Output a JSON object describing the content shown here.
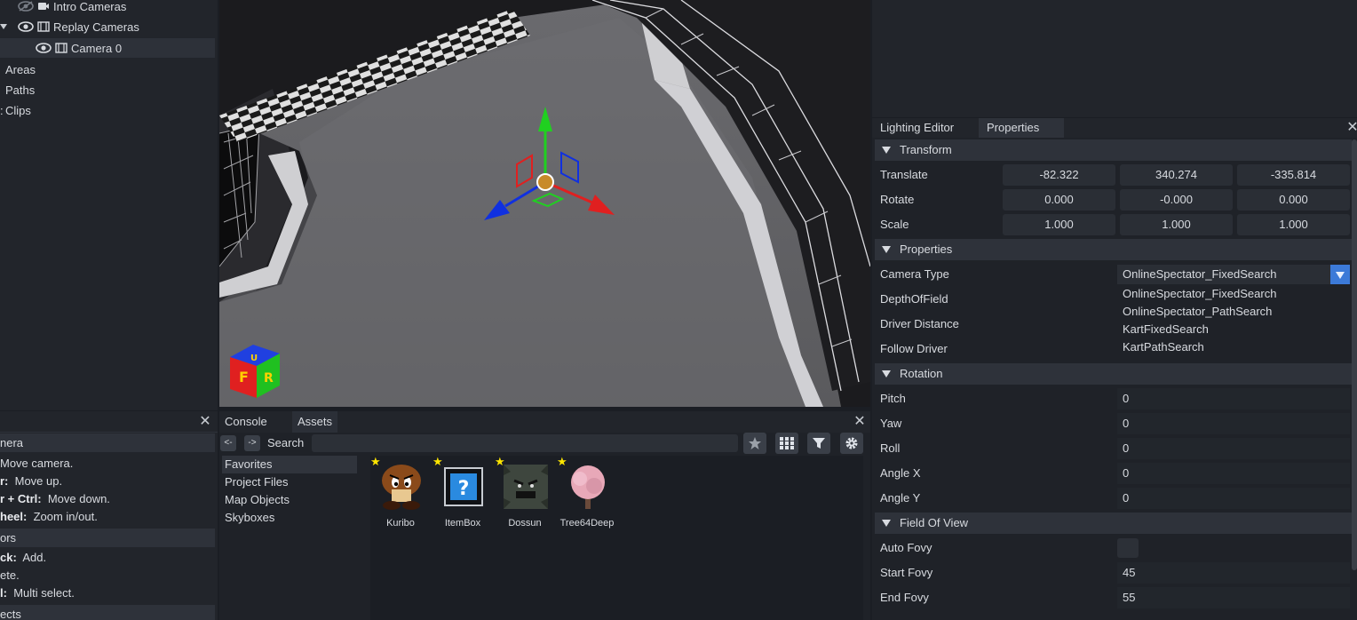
{
  "outliner": {
    "items": [
      {
        "label": "Intro Cameras"
      },
      {
        "label": "Replay Cameras"
      },
      {
        "label": "Camera 0"
      },
      {
        "label": "Areas"
      },
      {
        "label": "Paths"
      },
      {
        "label": "Clips"
      }
    ]
  },
  "help": {
    "sections": [
      {
        "title": "nera"
      },
      {
        "title": "ors"
      },
      {
        "title": "ects"
      }
    ],
    "lines": [
      {
        "key": "",
        "text": "Move camera."
      },
      {
        "key": "r:",
        "text": "Move up."
      },
      {
        "key": "r + Ctrl:",
        "text": "Move down."
      },
      {
        "key": "heel:",
        "text": "Zoom in/out."
      },
      {
        "key": "ck:",
        "text": "Add."
      },
      {
        "key": "",
        "text": "ete."
      },
      {
        "key": "l:",
        "text": "Multi select."
      }
    ]
  },
  "assets_panel": {
    "tabs": [
      "Console",
      "Assets"
    ],
    "back_label": "<-",
    "forward_label": "->",
    "search_label": "Search",
    "search_value": "",
    "categories": [
      "Favorites",
      "Project Files",
      "Map Objects",
      "Skyboxes"
    ],
    "items": [
      {
        "name": "Kuribo",
        "icon": "goomba-icon"
      },
      {
        "name": "ItemBox",
        "icon": "item-box-icon"
      },
      {
        "name": "Dossun",
        "icon": "thwomp-icon"
      },
      {
        "name": "Tree64Deep",
        "icon": "tree-icon"
      }
    ],
    "tools": [
      "star-icon",
      "grid-icon",
      "filter-icon",
      "gear-icon"
    ]
  },
  "right_panel": {
    "tabs": [
      "Lighting Editor",
      "Properties"
    ],
    "transform": {
      "title": "Transform",
      "rows": [
        {
          "label": "Translate",
          "values": [
            "-82.322",
            "340.274",
            "-335.814"
          ]
        },
        {
          "label": "Rotate",
          "values": [
            "0.000",
            "-0.000",
            "0.000"
          ]
        },
        {
          "label": "Scale",
          "values": [
            "1.000",
            "1.000",
            "1.000"
          ]
        }
      ]
    },
    "properties": {
      "title": "Properties",
      "labels": [
        "Camera Type",
        "DepthOfField",
        "Driver Distance",
        "Follow Driver"
      ],
      "camera_type_value": "OnlineSpectator_FixedSearch",
      "options": [
        "OnlineSpectator_FixedSearch",
        "OnlineSpectator_PathSearch",
        "KartFixedSearch",
        "KartPathSearch"
      ]
    },
    "rotation": {
      "title": "Rotation",
      "rows": [
        {
          "label": "Pitch",
          "value": "0"
        },
        {
          "label": "Yaw",
          "value": "0"
        },
        {
          "label": "Roll",
          "value": "0"
        },
        {
          "label": "Angle X",
          "value": "0"
        },
        {
          "label": "Angle Y",
          "value": "0"
        }
      ]
    },
    "fov": {
      "title": "Field Of View",
      "rows": [
        {
          "label": "Auto Fovy",
          "value": ""
        },
        {
          "label": "Start Fovy",
          "value": "45"
        },
        {
          "label": "End Fovy",
          "value": "55"
        }
      ]
    }
  },
  "colors": {
    "accent": "#3c7ad8",
    "gizmo_x": "#e02020",
    "gizmo_y": "#20d020",
    "gizmo_z": "#1030e0",
    "star": "#ffe600"
  }
}
